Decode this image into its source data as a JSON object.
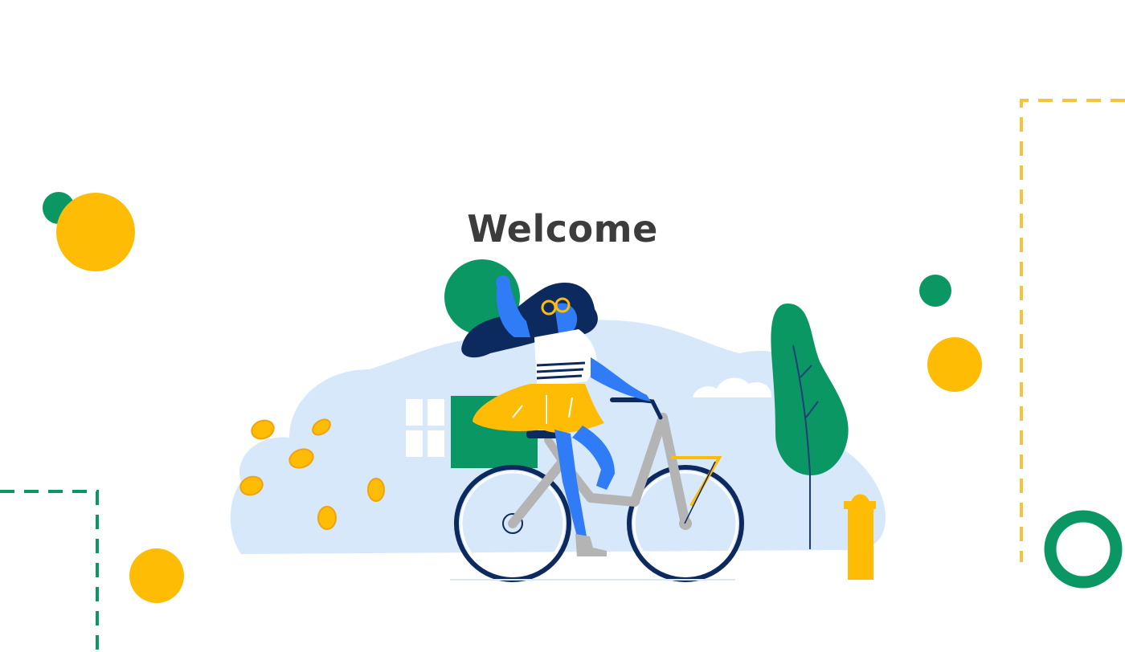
{
  "welcome": {
    "title": "Welcome"
  },
  "icons": {
    "hero": "woman-riding-bicycle-illustration",
    "decorations": [
      "dot",
      "ring",
      "dashed-frame",
      "tree",
      "fire-hydrant",
      "coins",
      "house-window",
      "cloud"
    ]
  },
  "colors": {
    "green": "#0b9764",
    "yellow": "#ffbc05",
    "dashed_yellow": "#f8c33c",
    "blue": "#2f7cf6",
    "navy": "#0d2a5e",
    "light_blue": "#d7e8fb",
    "gray": "#b4b4b4",
    "title": "#3c3c3c"
  }
}
